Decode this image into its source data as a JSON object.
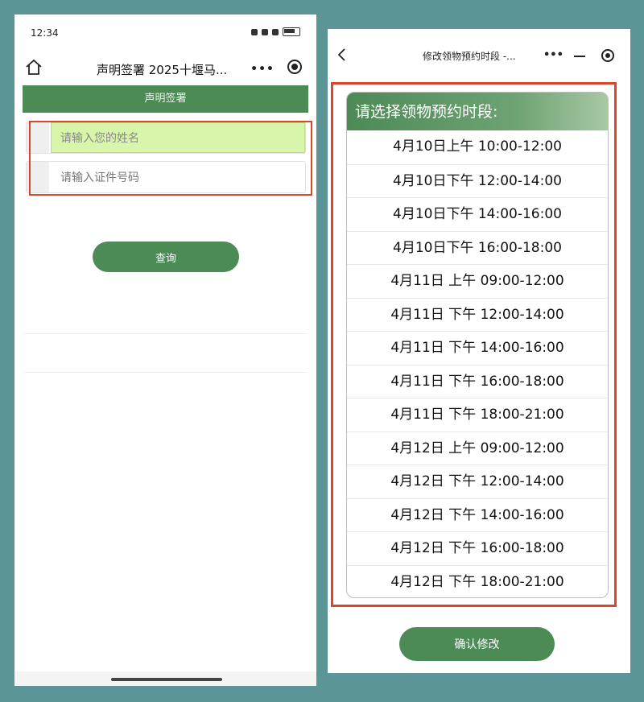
{
  "left_screen": {
    "status_time": "12:34",
    "nav_title": "声明签署 2025十堰马...",
    "section_header": "声明签署",
    "name_placeholder": "请输入您的姓名",
    "id_placeholder": "请输入证件号码",
    "query_button": "查询"
  },
  "right_screen": {
    "nav_title": "修改领物预约时段 -...",
    "panel_title": "请选择领物预约时段:",
    "slots": [
      "4月10日上午 10:00-12:00",
      "4月10日下午 12:00-14:00",
      "4月10日下午 14:00-16:00",
      "4月10日下午 16:00-18:00",
      "4月11日 上午 09:00-12:00",
      "4月11日 下午 12:00-14:00",
      "4月11日 下午 14:00-16:00",
      "4月11日 下午 16:00-18:00",
      "4月11日 下午 18:00-21:00",
      "4月12日 上午 09:00-12:00",
      "4月12日 下午 12:00-14:00",
      "4月12日 下午 14:00-16:00",
      "4月12日 下午 16:00-18:00",
      "4月12日 下午 18:00-21:00"
    ],
    "confirm_button": "确认修改"
  },
  "colors": {
    "background": "#5b9595",
    "brand_green": "#4c8a56",
    "highlight_red": "#d9462c",
    "name_field_bg": "#d9f5ab"
  },
  "icons": [
    "home-icon",
    "more-dots-icon",
    "target-icon",
    "back-icon",
    "minimize-icon"
  ]
}
